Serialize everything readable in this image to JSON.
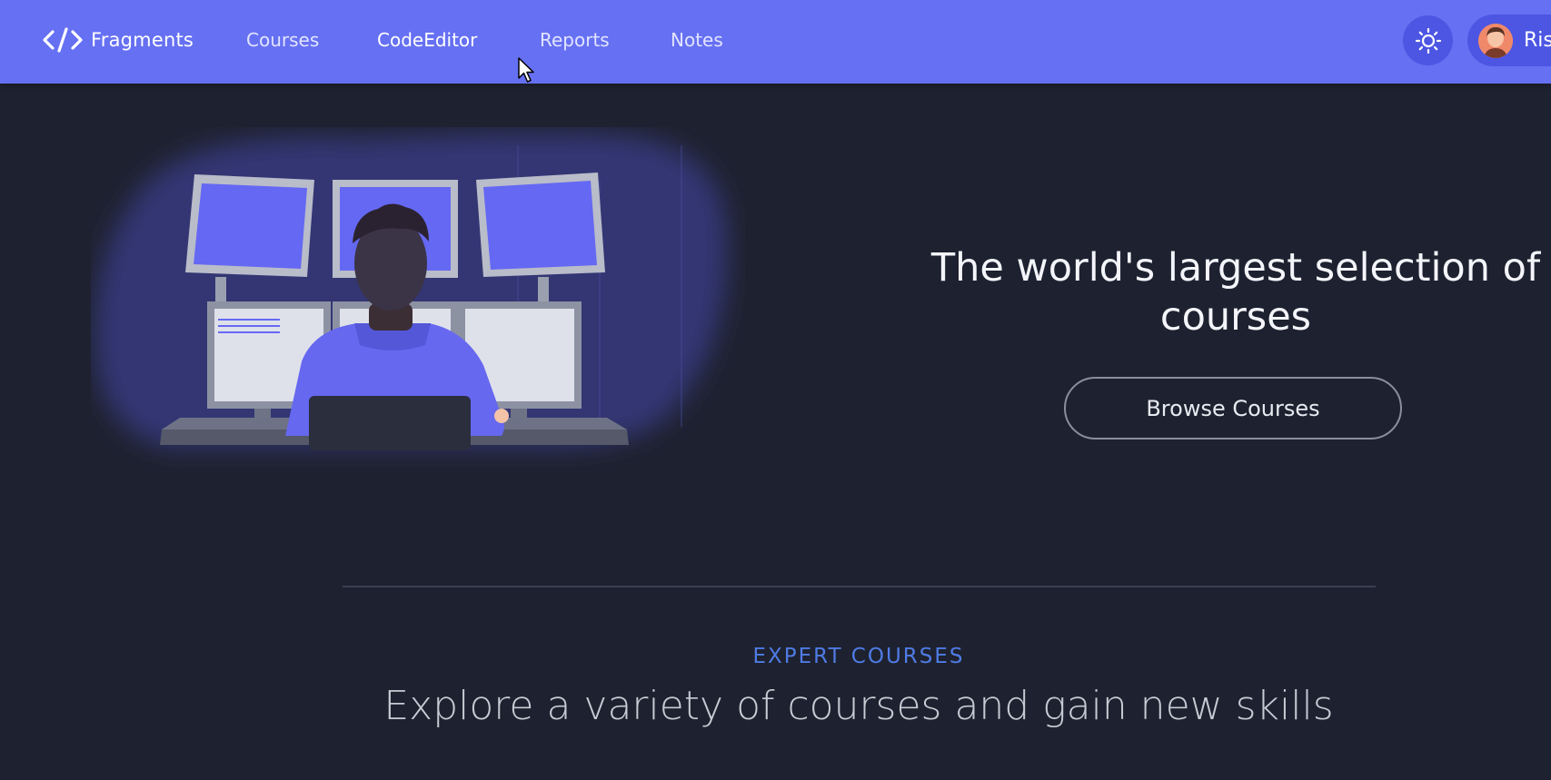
{
  "app": {
    "brand": "Fragments",
    "brand_icon": "code-icon"
  },
  "nav": {
    "links": [
      {
        "label": "Courses"
      },
      {
        "label": "CodeEditor"
      },
      {
        "label": "Reports"
      },
      {
        "label": "Notes"
      }
    ],
    "active": "CodeEditor",
    "theme_icon": "sun-icon",
    "profile_name": "Ris"
  },
  "hero": {
    "title_line1": "The world's largest selection of",
    "title_line2": "courses",
    "cta_label": "Browse Courses",
    "illustration": "developer-at-monitors-illustration"
  },
  "section": {
    "eyebrow": "EXPERT COURSES",
    "heading": "Explore a variety of courses and gain new skills"
  },
  "colors": {
    "navbar": "#6670f2",
    "background": "#1e2230",
    "accent": "#4f7be4"
  }
}
